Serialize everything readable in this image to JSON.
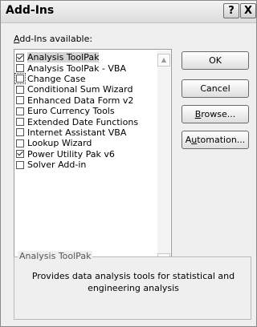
{
  "window": {
    "title": "Add-Ins",
    "help_label": "?",
    "close_label": "X"
  },
  "list": {
    "label_prefix": "",
    "label_accel": "A",
    "label_rest": "dd-Ins available:",
    "items": [
      {
        "label": "Analysis ToolPak",
        "checked": true
      },
      {
        "label": "Analysis ToolPak - VBA",
        "checked": false
      },
      {
        "label": "Change Case",
        "checked": false
      },
      {
        "label": "Conditional Sum Wizard",
        "checked": false
      },
      {
        "label": "Enhanced Data Form v2",
        "checked": false
      },
      {
        "label": "Euro Currency Tools",
        "checked": false
      },
      {
        "label": "Extended Date Functions",
        "checked": false
      },
      {
        "label": "Internet Assistant VBA",
        "checked": false
      },
      {
        "label": "Lookup Wizard",
        "checked": false
      },
      {
        "label": "Power Utility Pak v6",
        "checked": true
      },
      {
        "label": "Solver Add-in",
        "checked": false
      }
    ],
    "scroll_up": "▲",
    "scroll_down": "▼"
  },
  "buttons": {
    "ok": "OK",
    "cancel": "Cancel",
    "browse_accel": "B",
    "browse_rest": "rowse...",
    "auto_prefix": "A",
    "auto_accel": "u",
    "auto_rest": "tomation..."
  },
  "description": {
    "title": "Analysis ToolPak",
    "text": "Provides data analysis tools for statistical and engineering analysis"
  }
}
